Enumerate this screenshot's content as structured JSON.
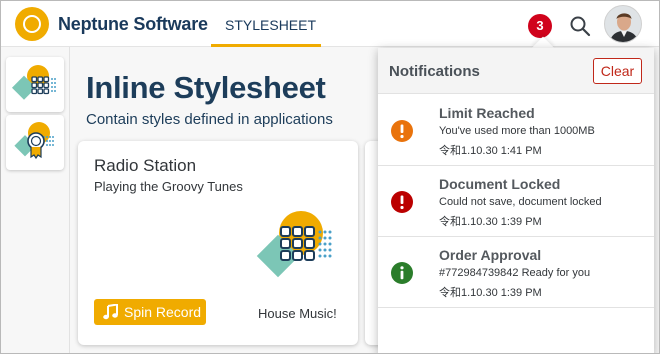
{
  "shell": {
    "brand": "Neptune Software",
    "tab_label": "STYLESHEET",
    "notification_count": "3",
    "colors": {
      "accent": "#f0ab00",
      "brand_text": "#1a3a5c",
      "badge": "#d0021b"
    }
  },
  "rail": {
    "items": [
      {
        "icon": "grid-app-icon"
      },
      {
        "icon": "badge-award-icon"
      }
    ]
  },
  "main": {
    "title": "Inline Stylesheet",
    "subtitle": "Contain styles defined in applications"
  },
  "card": {
    "title": "Radio Station",
    "subtitle": "Playing the Groovy Tunes",
    "button_label": "Spin Record",
    "footer": "House Music!"
  },
  "notifications": {
    "title": "Notifications",
    "clear_label": "Clear",
    "items": [
      {
        "title": "Limit Reached",
        "description": "You've used more than 1000MB",
        "timestamp": "令和1.10.30 1:41 PM",
        "icon": "warning-icon",
        "color": "#e9730c"
      },
      {
        "title": "Document Locked",
        "description": "Could not save, document locked",
        "timestamp": "令和1.10.30 1:39 PM",
        "icon": "error-icon",
        "color": "#bb0000"
      },
      {
        "title": "Order Approval",
        "description": "#772984739842 Ready for you",
        "timestamp": "令和1.10.30 1:39 PM",
        "icon": "info-icon",
        "color": "#2b7d2b"
      }
    ]
  }
}
